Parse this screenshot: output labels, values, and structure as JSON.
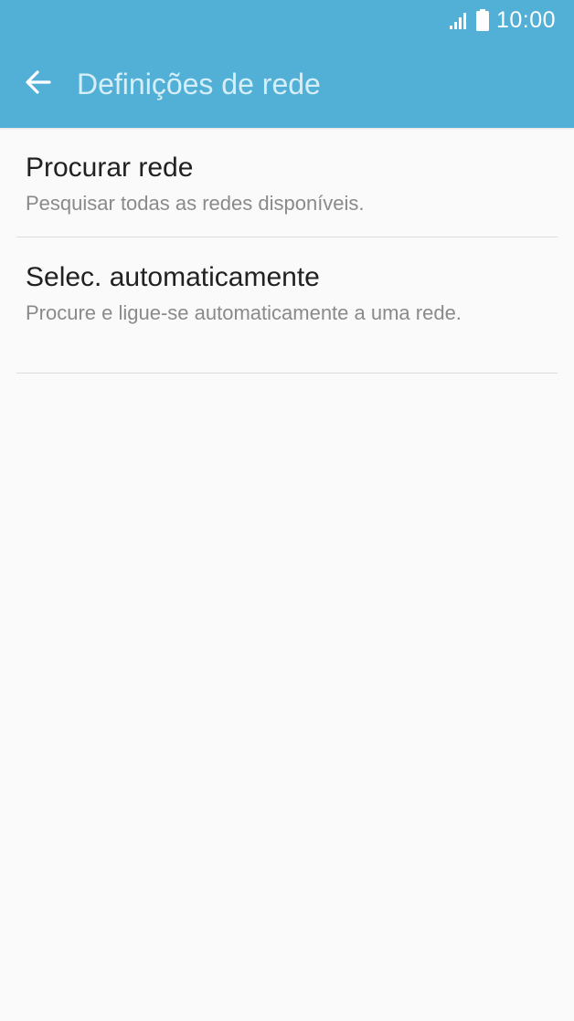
{
  "colors": {
    "app_bar": "#52b0d7",
    "title_text": "#d6eef8",
    "background": "#fafafa",
    "primary_text": "#212121",
    "secondary_text": "#8a8a8a",
    "divider": "#dcdcdc"
  },
  "status_bar": {
    "time": "10:00",
    "icons": [
      "signal-icon",
      "battery-icon"
    ]
  },
  "toolbar": {
    "back_icon": "arrow-left-icon",
    "title": "Definições de rede"
  },
  "list": {
    "items": [
      {
        "title": "Procurar rede",
        "subtitle": "Pesquisar todas as redes disponíveis."
      },
      {
        "title": "Selec. automaticamente",
        "subtitle": "Procure e ligue-se automaticamente a uma rede."
      }
    ]
  }
}
